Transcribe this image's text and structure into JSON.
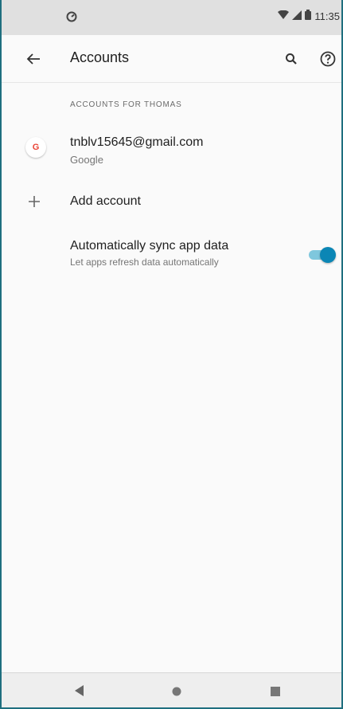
{
  "status_bar": {
    "time": "11:35",
    "icons": [
      "notification-icon",
      "wifi-icon",
      "signal-icon",
      "battery-icon"
    ]
  },
  "app_bar": {
    "title": "Accounts",
    "icons": [
      "back-arrow-icon",
      "search-icon",
      "help-icon"
    ]
  },
  "accounts": {
    "section_header": "ACCOUNTS FOR THOMAS",
    "items": [
      {
        "email": "tnblv15645@gmail.com",
        "provider": "Google",
        "icon": "google-icon"
      }
    ],
    "add_account_label": "Add account",
    "add_icon": "plus-icon"
  },
  "sync": {
    "title": "Automatically sync app data",
    "subtitle": "Let apps refresh data automatically",
    "enabled": true,
    "track_color": "#7fc7dd",
    "thumb_color": "#0b86b5"
  },
  "nav_bar": {
    "buttons": [
      "back-triangle-icon",
      "home-circle-icon",
      "recents-square-icon"
    ]
  },
  "colors": {
    "status_bar_bg": "#e0e0e0",
    "screen_bg": "#fafafa",
    "frame": "#1f6f7f"
  }
}
